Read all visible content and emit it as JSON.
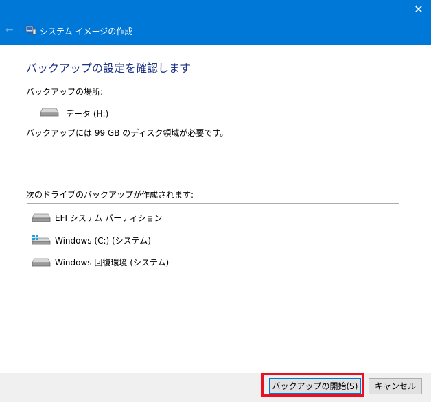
{
  "window": {
    "title": "システム イメージの作成",
    "close_glyph": "✕",
    "back_glyph": "←"
  },
  "heading": "バックアップの設定を確認します",
  "location": {
    "label": "バックアップの場所:",
    "drive_name": "データ (H:)",
    "space_note": "バックアップには 99 GB のディスク領域が必要です。"
  },
  "drives_section": {
    "label": "次のドライブのバックアップが作成されます:",
    "items": [
      {
        "label": "EFI システム パーティション",
        "icon": "drive-icon"
      },
      {
        "label": "Windows (C:) (システム)",
        "icon": "windows-drive-icon"
      },
      {
        "label": "Windows 回復環境 (システム)",
        "icon": "drive-icon"
      }
    ]
  },
  "buttons": {
    "start_backup": "バックアップの開始(S)",
    "cancel": "キャンセル"
  },
  "colors": {
    "titlebar": "#0078d7",
    "heading": "#1e3287",
    "highlight": "#e81123"
  }
}
